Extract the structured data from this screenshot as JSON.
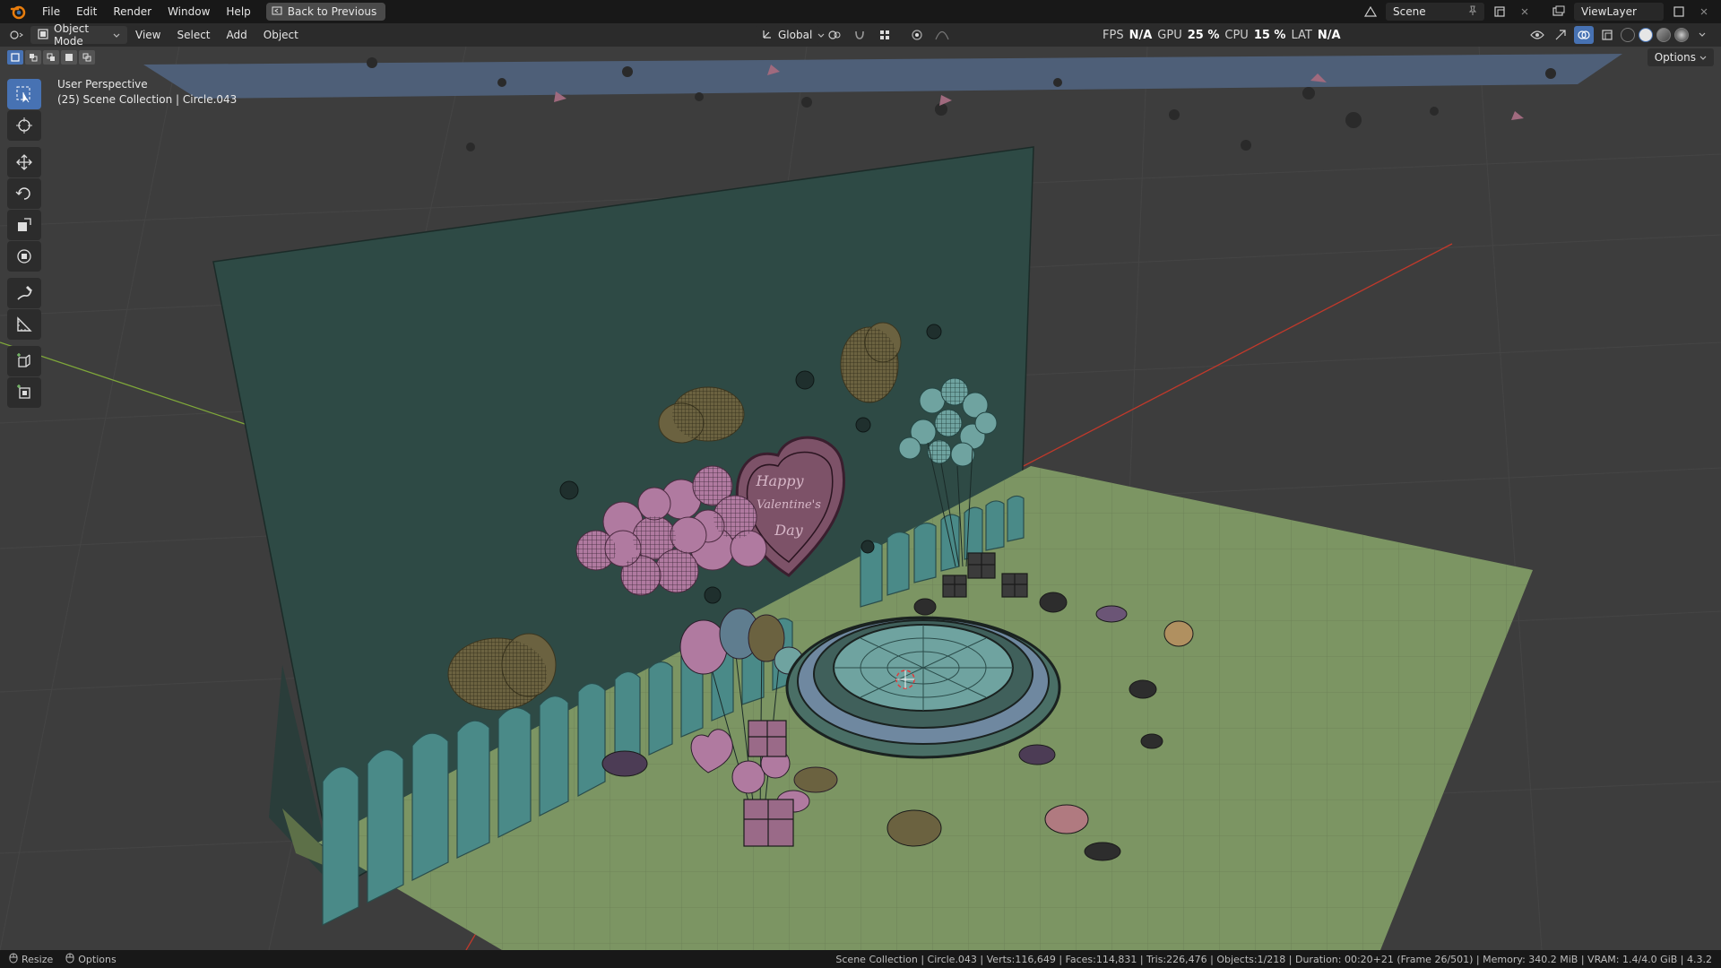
{
  "app": {
    "logo_icon": "blender-icon"
  },
  "topbar": {
    "menus": [
      "File",
      "Edit",
      "Render",
      "Window",
      "Help"
    ],
    "back_button": "Back to Previous",
    "scene_name": "Scene",
    "view_layer": "ViewLayer"
  },
  "header": {
    "mode": "Object Mode",
    "menus": [
      "View",
      "Select",
      "Add",
      "Object"
    ],
    "transform_orientation": "Global"
  },
  "stats": {
    "fps_label": "FPS",
    "fps_value": "N/A",
    "gpu_label": "GPU",
    "gpu_value": "25 %",
    "cpu_label": "CPU",
    "cpu_value": "15 %",
    "lat_label": "LAT",
    "lat_value": "N/A"
  },
  "viewport": {
    "perspective": "User Perspective",
    "collection_info": "(25) Scene Collection | Circle.043",
    "options_label": "Options",
    "greeting_lines": [
      "Happy",
      "Valentine's",
      "Day"
    ]
  },
  "toolbar": {
    "tools": [
      "select-box-icon",
      "cursor-icon",
      "move-icon",
      "rotate-icon",
      "scale-icon",
      "transform-icon",
      "annotate-icon",
      "measure-icon",
      "add-cube-icon",
      "add-object-icon"
    ]
  },
  "statusbar": {
    "left": [
      "Resize",
      "Options"
    ],
    "info": "Scene Collection | Circle.043 | Verts:116,649 | Faces:114,831 | Tris:226,476 | Objects:1/218 | Duration: 00:20+21 (Frame 26/501) | Memory: 340.2 MiB | VRAM: 1.4/4.0 GiB | 4.3.2"
  },
  "colors": {
    "accent": "#4772b3",
    "backdrop_wall": "#2e4a45",
    "floor": "#7c9563",
    "balloon_pink": "#b07aa0",
    "balloon_teal": "#6fa3a0",
    "cloud_olive": "#6b6240",
    "axis_x": "#c0392b",
    "axis_y": "#7fa83a"
  }
}
